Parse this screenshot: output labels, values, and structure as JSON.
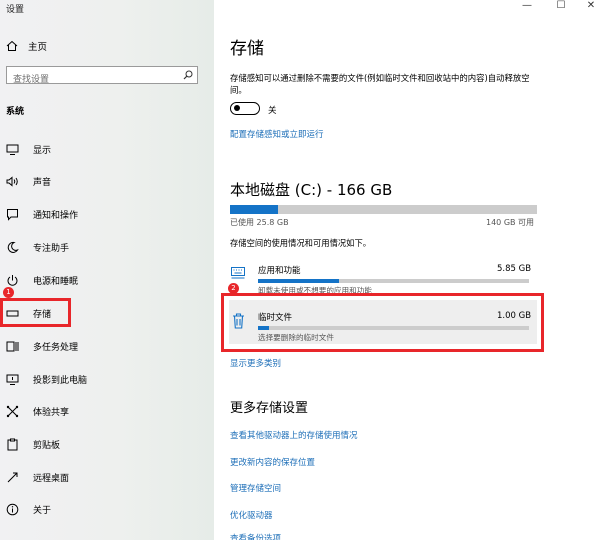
{
  "window": {
    "title": "设置",
    "min": "—",
    "max": "☐",
    "close": "✕"
  },
  "sidebar": {
    "home": "主页",
    "search_placeholder": "查找设置",
    "section": "系统",
    "items": [
      {
        "label": "显示",
        "icon": "monitor-icon"
      },
      {
        "label": "声音",
        "icon": "speaker-icon"
      },
      {
        "label": "通知和操作",
        "icon": "notification-icon"
      },
      {
        "label": "专注助手",
        "icon": "moon-icon"
      },
      {
        "label": "电源和睡眠",
        "icon": "power-icon"
      },
      {
        "label": "存储",
        "icon": "storage-icon"
      },
      {
        "label": "多任务处理",
        "icon": "multitask-icon"
      },
      {
        "label": "投影到此电脑",
        "icon": "project-icon"
      },
      {
        "label": "体验共享",
        "icon": "share-icon"
      },
      {
        "label": "剪贴板",
        "icon": "clipboard-icon"
      },
      {
        "label": "远程桌面",
        "icon": "remote-desktop-icon"
      },
      {
        "label": "关于",
        "icon": "info-icon"
      }
    ]
  },
  "annotations": {
    "badge1": "1",
    "badge2": "2"
  },
  "main": {
    "title": "存储",
    "description": "存储感知可以通过删除不需要的文件(例如临时文件和回收站中的内容)自动释放空间。",
    "toggle_label": "关",
    "toggle_on": false,
    "configure_link": "配置存储感知或立即运行",
    "disk": {
      "title": "本地磁盘 (C:) - 166 GB",
      "used": "已使用 25.8 GB",
      "free": "140 GB 可用",
      "used_fraction": 0.155,
      "usage_desc": "存储空间的使用情况和可用情况如下。",
      "categories": [
        {
          "name": "应用和功能",
          "size": "5.85 GB",
          "sub": "卸载未使用或不想要的应用和功能",
          "fraction": 0.3,
          "icon": "keyboard-icon"
        },
        {
          "name": "临时文件",
          "size": "1.00 GB",
          "sub": "选择要删除的临时文件",
          "fraction": 0.04,
          "icon": "trash-icon"
        }
      ],
      "more_categories": "显示更多类别"
    },
    "more_settings": {
      "title": "更多存储设置",
      "links": [
        "查看其他驱动器上的存储使用情况",
        "更改新内容的保存位置",
        "管理存储空间",
        "优化驱动器",
        "查看备份选项"
      ]
    }
  }
}
